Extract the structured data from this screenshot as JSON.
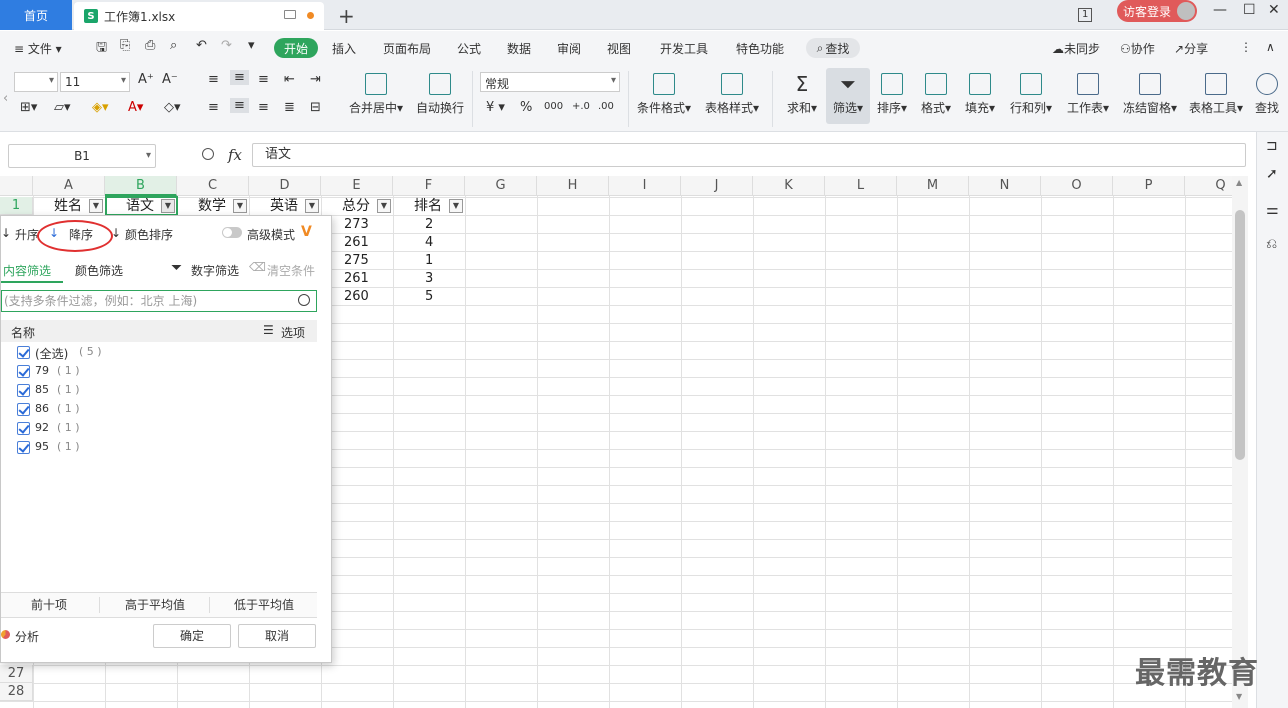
{
  "titlebar": {
    "home": "首页",
    "file_name": "工作簿1.xlsx",
    "s_logo": "S",
    "new_tab": "+",
    "window_number": "1",
    "login": "访客登录",
    "min": "—",
    "max": "☐",
    "close": "✕"
  },
  "menubar": {
    "items": [
      "≡ 文件 ▾",
      "开始",
      "插入",
      "页面布局",
      "公式",
      "数据",
      "审阅",
      "视图",
      "开发工具",
      "特色功能"
    ],
    "search": "查找",
    "right": [
      "未同步",
      "协作",
      "分享",
      "⋮",
      "∧"
    ]
  },
  "ribbon": {
    "font_name": "",
    "font_size": "11",
    "number_format": "常规",
    "buttons": {
      "merge": "合并居中▾",
      "wrap": "自动换行",
      "cond": "条件格式▾",
      "table_style": "表格样式▾",
      "sum": "求和▾",
      "filter": "筛选▾",
      "sort": "排序▾",
      "format": "格式▾",
      "fill": "填充▾",
      "rowcol": "行和列▾",
      "sheet": "工作表▾",
      "freeze": "冻结窗格▾",
      "tools": "表格工具▾",
      "find": "查找"
    },
    "currency": "¥ ▾",
    "percent": "%",
    "thousand": "000",
    "inc_dec": "+.0",
    "dec_dec": ".00"
  },
  "formulabar": {
    "namebox": "B1",
    "fx": "fx",
    "content": "语文"
  },
  "grid": {
    "columns": [
      "A",
      "B",
      "C",
      "D",
      "E",
      "F",
      "G",
      "H",
      "I",
      "J",
      "K",
      "L",
      "M",
      "N",
      "O",
      "P",
      "Q"
    ],
    "rows_visible": [
      "1",
      "27",
      "28"
    ],
    "headers": [
      "姓名",
      "语文",
      "数学",
      "英语",
      "总分",
      "排名"
    ],
    "totals": [
      "273",
      "261",
      "275",
      "261",
      "260"
    ],
    "ranks": [
      "2",
      "4",
      "1",
      "3",
      "5"
    ]
  },
  "filter_popup": {
    "asc": "升序",
    "desc": "降序",
    "color_sort": "颜色排序",
    "advanced": "高级模式",
    "tab_content": "内容筛选",
    "tab_color": "颜色筛选",
    "num_filter": "数字筛选",
    "clear": "清空条件",
    "search_placeholder": "(支持多条件过滤，例如：北京 上海)",
    "list_name": "名称",
    "list_options": "选项",
    "items": [
      {
        "label": "(全选)",
        "count": "( 5 )"
      },
      {
        "label": "79",
        "count": "( 1 )"
      },
      {
        "label": "85",
        "count": "( 1 )"
      },
      {
        "label": "86",
        "count": "( 1 )"
      },
      {
        "label": "92",
        "count": "( 1 )"
      },
      {
        "label": "95",
        "count": "( 1 )"
      }
    ],
    "top10": "前十项",
    "above_avg": "高于平均值",
    "below_avg": "低于平均值",
    "analysis": "分析",
    "ok": "确定",
    "cancel": "取消"
  },
  "watermark": "最需教育"
}
